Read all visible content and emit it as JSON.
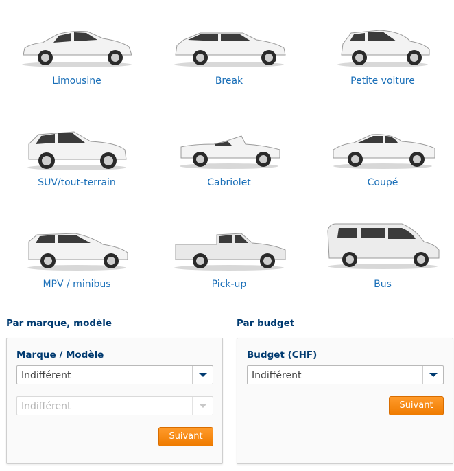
{
  "cars": [
    {
      "label": "Limousine"
    },
    {
      "label": "Break"
    },
    {
      "label": "Petite voiture"
    },
    {
      "label": "SUV/tout-terrain"
    },
    {
      "label": "Cabriolet"
    },
    {
      "label": "Coupé"
    },
    {
      "label": "MPV / minibus"
    },
    {
      "label": "Pick-up"
    },
    {
      "label": "Bus"
    }
  ],
  "brand_section": {
    "title": "Par marque, modèle",
    "field_label": "Marque / Modèle",
    "brand_select_value": "Indifférent",
    "model_select_value": "Indifférent",
    "submit_label": "Suivant"
  },
  "budget_section": {
    "title": "Par budget",
    "field_label": "Budget (CHF)",
    "budget_select_value": "Indifférent",
    "submit_label": "Suivant"
  },
  "colors": {
    "accent_orange": "#f08000",
    "navy": "#003a70",
    "link_blue": "#1a6fb8"
  }
}
